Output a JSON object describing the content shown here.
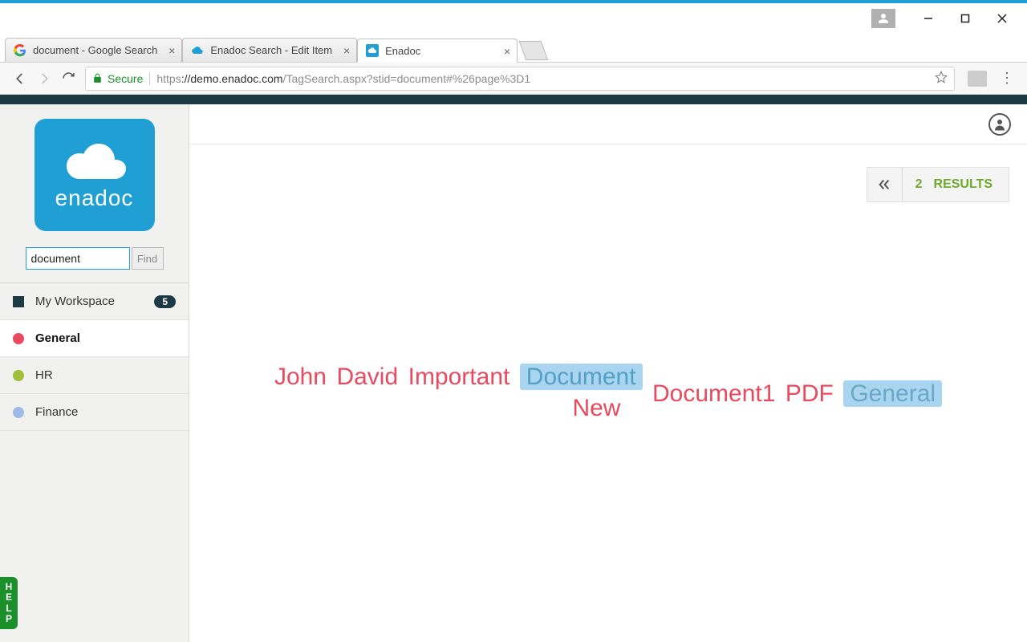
{
  "window": {
    "minimize": "—",
    "maximize": "☐",
    "close": "✕"
  },
  "tabs": [
    {
      "label": "document - Google Search",
      "favicon": "google"
    },
    {
      "label": "Enadoc Search - Edit Item",
      "favicon": "enadoc-fav"
    },
    {
      "label": "Enadoc",
      "favicon": "enadoc-cloud",
      "active": true
    }
  ],
  "address": {
    "secure_label": "Secure",
    "proto": "https",
    "host": "://demo.enadoc.com",
    "path": "/TagSearch.aspx?stid=document#%26page%3D1"
  },
  "logo_text": "enadoc",
  "search": {
    "value": "document",
    "find": "Find"
  },
  "nav": [
    {
      "label": "My Workspace",
      "color": "#1c3a44",
      "shape": "square",
      "badge": "5"
    },
    {
      "label": "General",
      "color": "#e84a5f",
      "shape": "dot",
      "active": true
    },
    {
      "label": "HR",
      "color": "#9fbf3d",
      "shape": "dot"
    },
    {
      "label": "Finance",
      "color": "#9fb9e8",
      "shape": "dot"
    }
  ],
  "results": {
    "count": "2",
    "label": "RESULTS"
  },
  "tags_line1": [
    {
      "text": "John"
    },
    {
      "text": "David"
    },
    {
      "text": "Important"
    },
    {
      "text": "Document",
      "highlight": true
    }
  ],
  "tags_line2_left": {
    "text": "New"
  },
  "tags_line2_right": [
    {
      "text": "Document1"
    },
    {
      "text": "PDF"
    },
    {
      "text": "General",
      "highlight": true
    }
  ],
  "help": {
    "letters": [
      "H",
      "E",
      "L",
      "P"
    ]
  }
}
